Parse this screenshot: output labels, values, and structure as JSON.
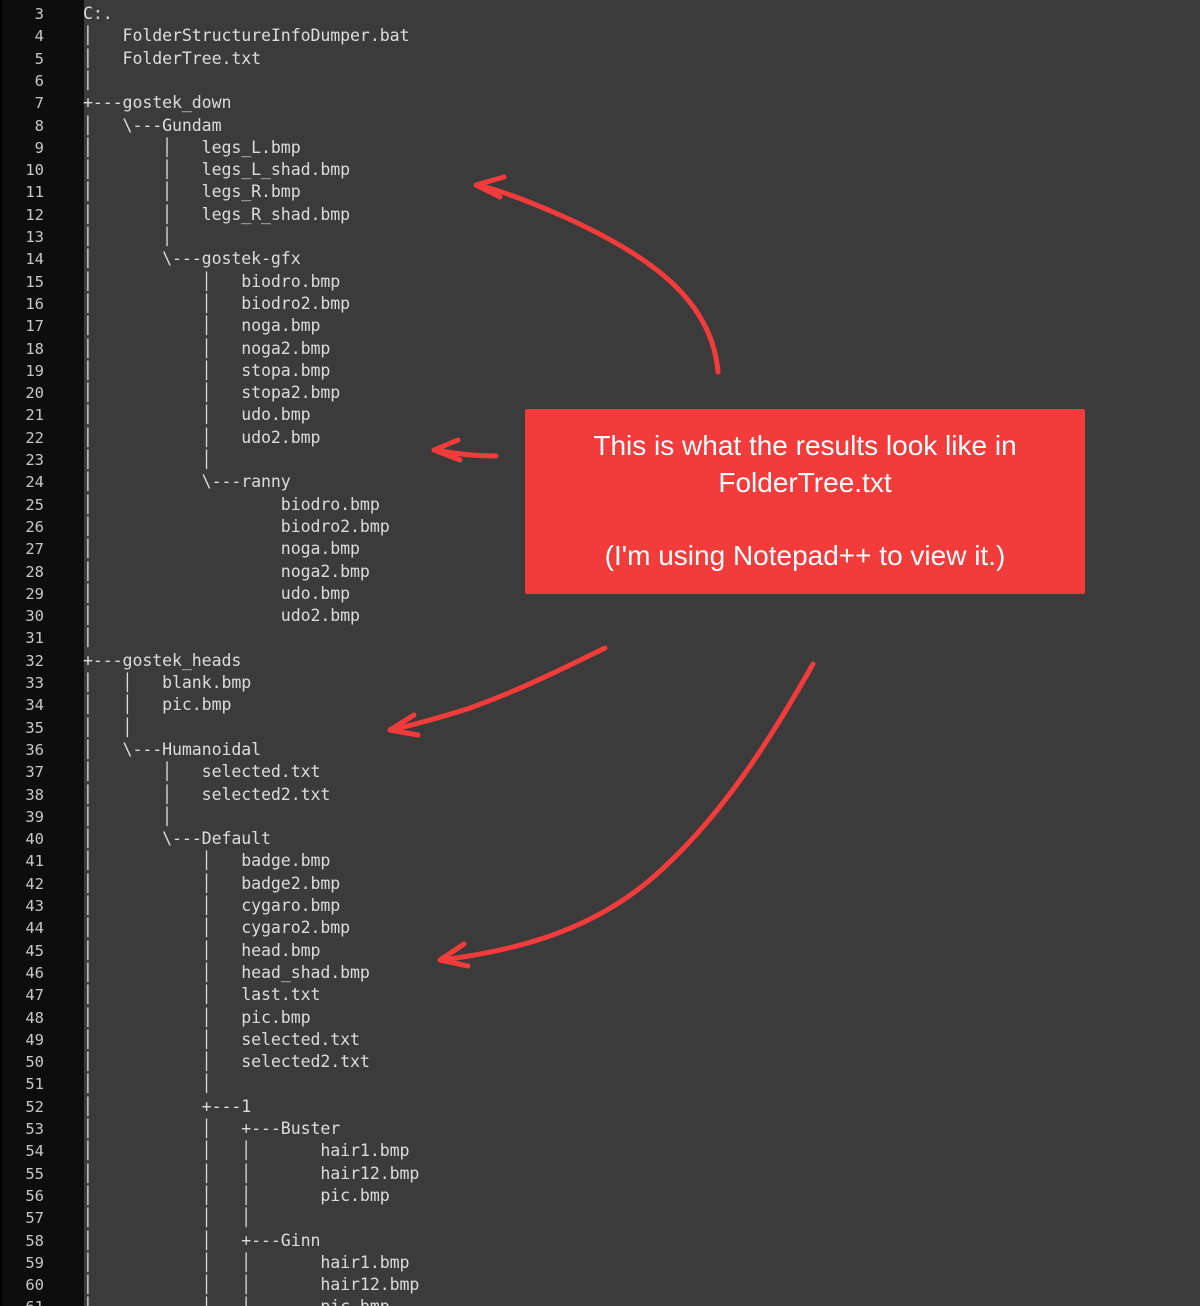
{
  "editor": {
    "first_line_number": 3,
    "lines": [
      "C:.",
      "│   FolderStructureInfoDumper.bat",
      "│   FolderTree.txt",
      "│",
      "+---gostek_down",
      "│   \\---Gundam",
      "│       │   legs_L.bmp",
      "│       │   legs_L_shad.bmp",
      "│       │   legs_R.bmp",
      "│       │   legs_R_shad.bmp",
      "│       │",
      "│       \\---gostek-gfx",
      "│           │   biodro.bmp",
      "│           │   biodro2.bmp",
      "│           │   noga.bmp",
      "│           │   noga2.bmp",
      "│           │   stopa.bmp",
      "│           │   stopa2.bmp",
      "│           │   udo.bmp",
      "│           │   udo2.bmp",
      "│           │",
      "│           \\---ranny",
      "│                   biodro.bmp",
      "│                   biodro2.bmp",
      "│                   noga.bmp",
      "│                   noga2.bmp",
      "│                   udo.bmp",
      "│                   udo2.bmp",
      "│",
      "+---gostek_heads",
      "│   │   blank.bmp",
      "│   │   pic.bmp",
      "│   │",
      "│   \\---Humanoidal",
      "│       │   selected.txt",
      "│       │   selected2.txt",
      "│       │",
      "│       \\---Default",
      "│           │   badge.bmp",
      "│           │   badge2.bmp",
      "│           │   cygaro.bmp",
      "│           │   cygaro2.bmp",
      "│           │   head.bmp",
      "│           │   head_shad.bmp",
      "│           │   last.txt",
      "│           │   pic.bmp",
      "│           │   selected.txt",
      "│           │   selected2.txt",
      "│           │",
      "│           +---1",
      "│           │   +---Buster",
      "│           │   │       hair1.bmp",
      "│           │   │       hair12.bmp",
      "│           │   │       pic.bmp",
      "│           │   │",
      "│           │   +---Ginn",
      "│           │   │       hair1.bmp",
      "│           │   │       hair12.bmp",
      "│           │   │       pic.bmp"
    ]
  },
  "callout": {
    "line1": "This is what the results look like in",
    "line2": "FolderTree.txt",
    "line3": "(I'm using Notepad++ to view it.)",
    "color": "#f23b3b"
  },
  "colors": {
    "editor_background": "#3b3b3b",
    "gutter_background": "#0d0d0d",
    "text": "#dcdcdc",
    "arrow": "#f23b3b"
  }
}
